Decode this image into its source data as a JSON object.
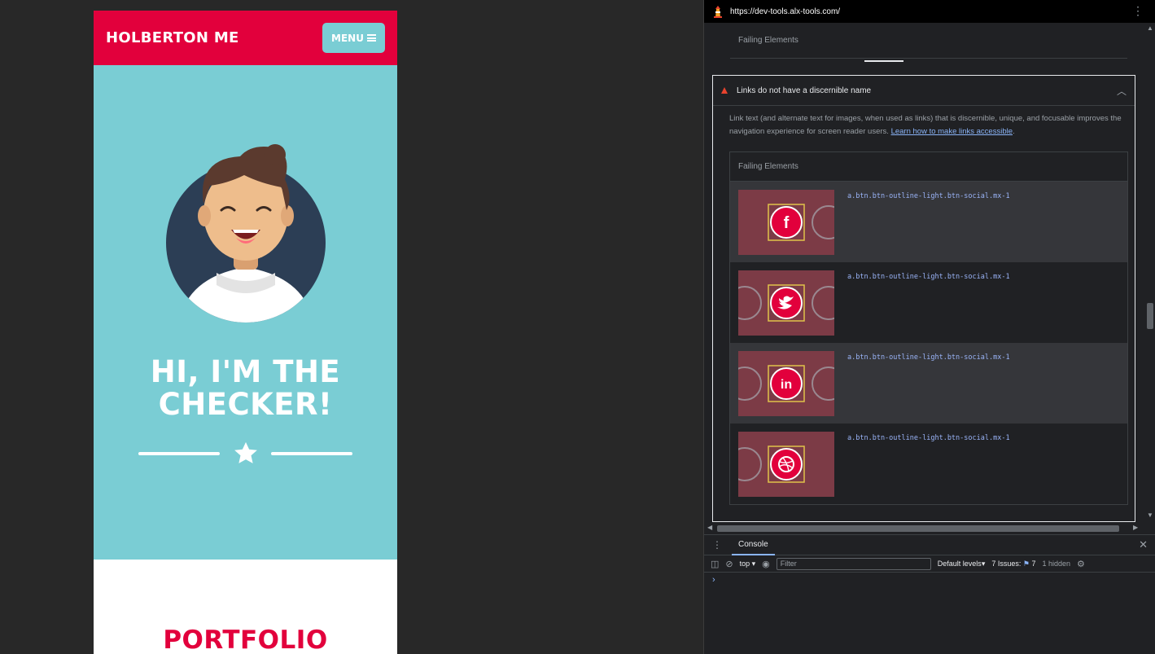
{
  "page": {
    "brand": "HOLBERTON ME",
    "menu_label": "MENU",
    "headline_line1": "HI, I'M THE",
    "headline_line2": "CHECKER!",
    "section_title": "PORTFOLIO"
  },
  "devtools": {
    "url": "https://dev-tools.alx-tools.com/",
    "top_failing_label": "Failing Elements",
    "audit": {
      "title": "Links do not have a discernible name",
      "description": "Link text (and alternate text for images, when used as links) that is discernible, unique, and focusable improves the navigation experience for screen reader users.",
      "learn_link": "Learn how to make links accessible",
      "failing_label": "Failing Elements",
      "rows": [
        {
          "selector": "a.btn.btn-outline-light.btn-social.mx-1",
          "icon": "facebook-icon"
        },
        {
          "selector": "a.btn.btn-outline-light.btn-social.mx-1",
          "icon": "twitter-icon"
        },
        {
          "selector": "a.btn.btn-outline-light.btn-social.mx-1",
          "icon": "linkedin-icon"
        },
        {
          "selector": "a.btn.btn-outline-light.btn-social.mx-1",
          "icon": "dribbble-icon"
        }
      ]
    },
    "drawer": {
      "tab": "Console",
      "context": "top",
      "filter_placeholder": "Filter",
      "levels": "Default levels",
      "issues": "7 Issues:",
      "issues_count": "7",
      "hidden": "1 hidden"
    }
  },
  "colors": {
    "brand_red": "#e2003c",
    "teal": "#7acdd4",
    "devtools_bg": "#202124",
    "link_blue": "#8ab4f8"
  }
}
